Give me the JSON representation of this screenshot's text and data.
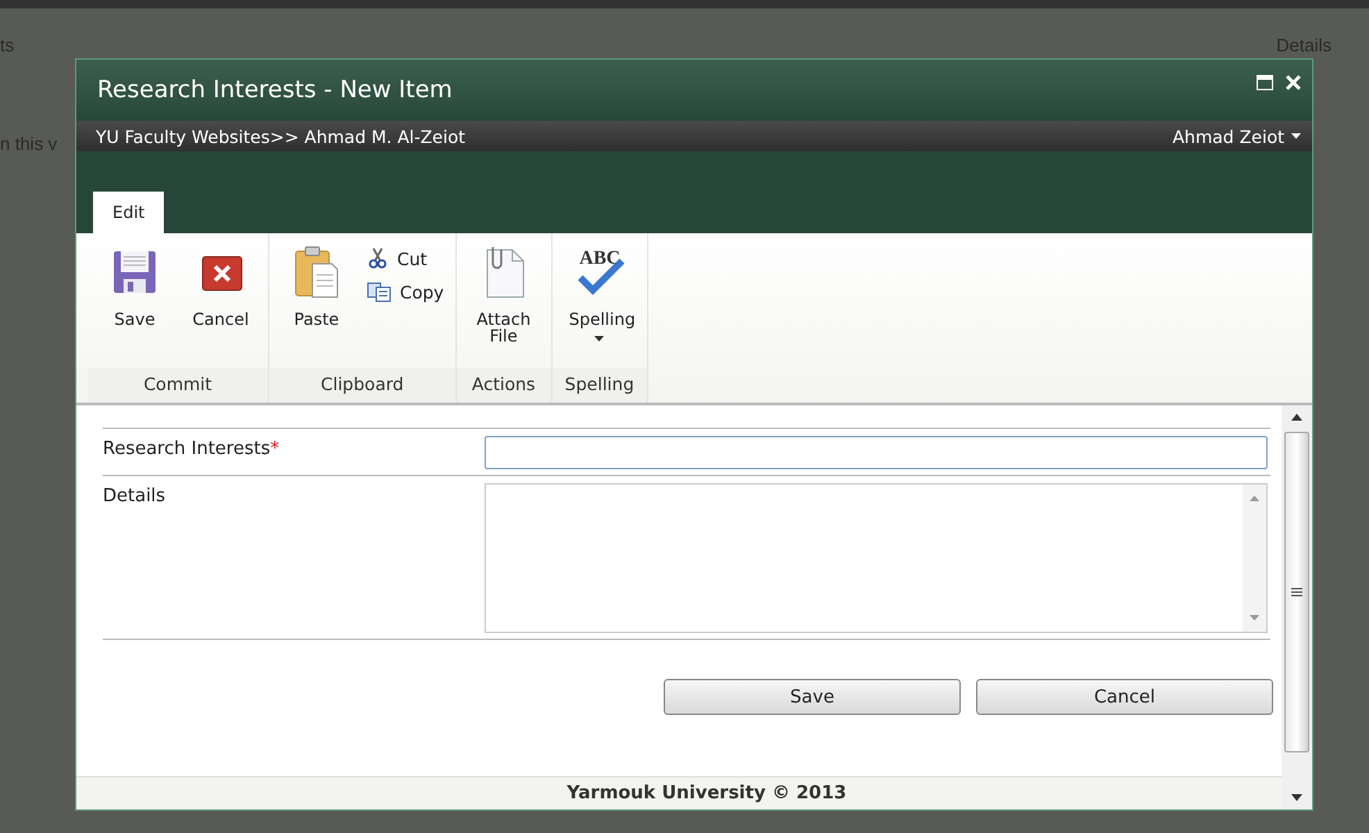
{
  "background": {
    "texts": [
      "ts",
      "n this v"
    ],
    "column_heading": "Details"
  },
  "window": {
    "title": "Research Interests - New Item"
  },
  "breadcrumb": "YU Faculty Websites>> Ahmad M. Al-Zeiot",
  "user": "Ahmad Zeiot",
  "tabs": [
    {
      "label": "Edit",
      "selected": true
    }
  ],
  "ribbon_groups": [
    {
      "label": "Commit",
      "items": [
        {
          "kind": "large",
          "label": "Save"
        },
        {
          "kind": "large",
          "label": "Cancel"
        }
      ]
    },
    {
      "label": "Clipboard",
      "items": [
        {
          "kind": "large",
          "label": "Paste"
        },
        {
          "kind": "small",
          "label": "Cut"
        },
        {
          "kind": "small",
          "label": "Copy"
        }
      ]
    },
    {
      "label": "Actions",
      "items": [
        {
          "kind": "large",
          "label": "Attach File"
        }
      ]
    },
    {
      "label": "Spelling",
      "items": [
        {
          "kind": "large",
          "icon_text": "ABC",
          "label": "Spelling",
          "dropdown": true
        }
      ]
    }
  ],
  "fields": [
    {
      "kind": "text",
      "label": "Research Interests",
      "marker": "*"
    },
    {
      "kind": "multiline",
      "label": "Details"
    }
  ],
  "buttons": [
    "Save",
    "Cancel"
  ],
  "footer": "Yarmouk University © 2013"
}
